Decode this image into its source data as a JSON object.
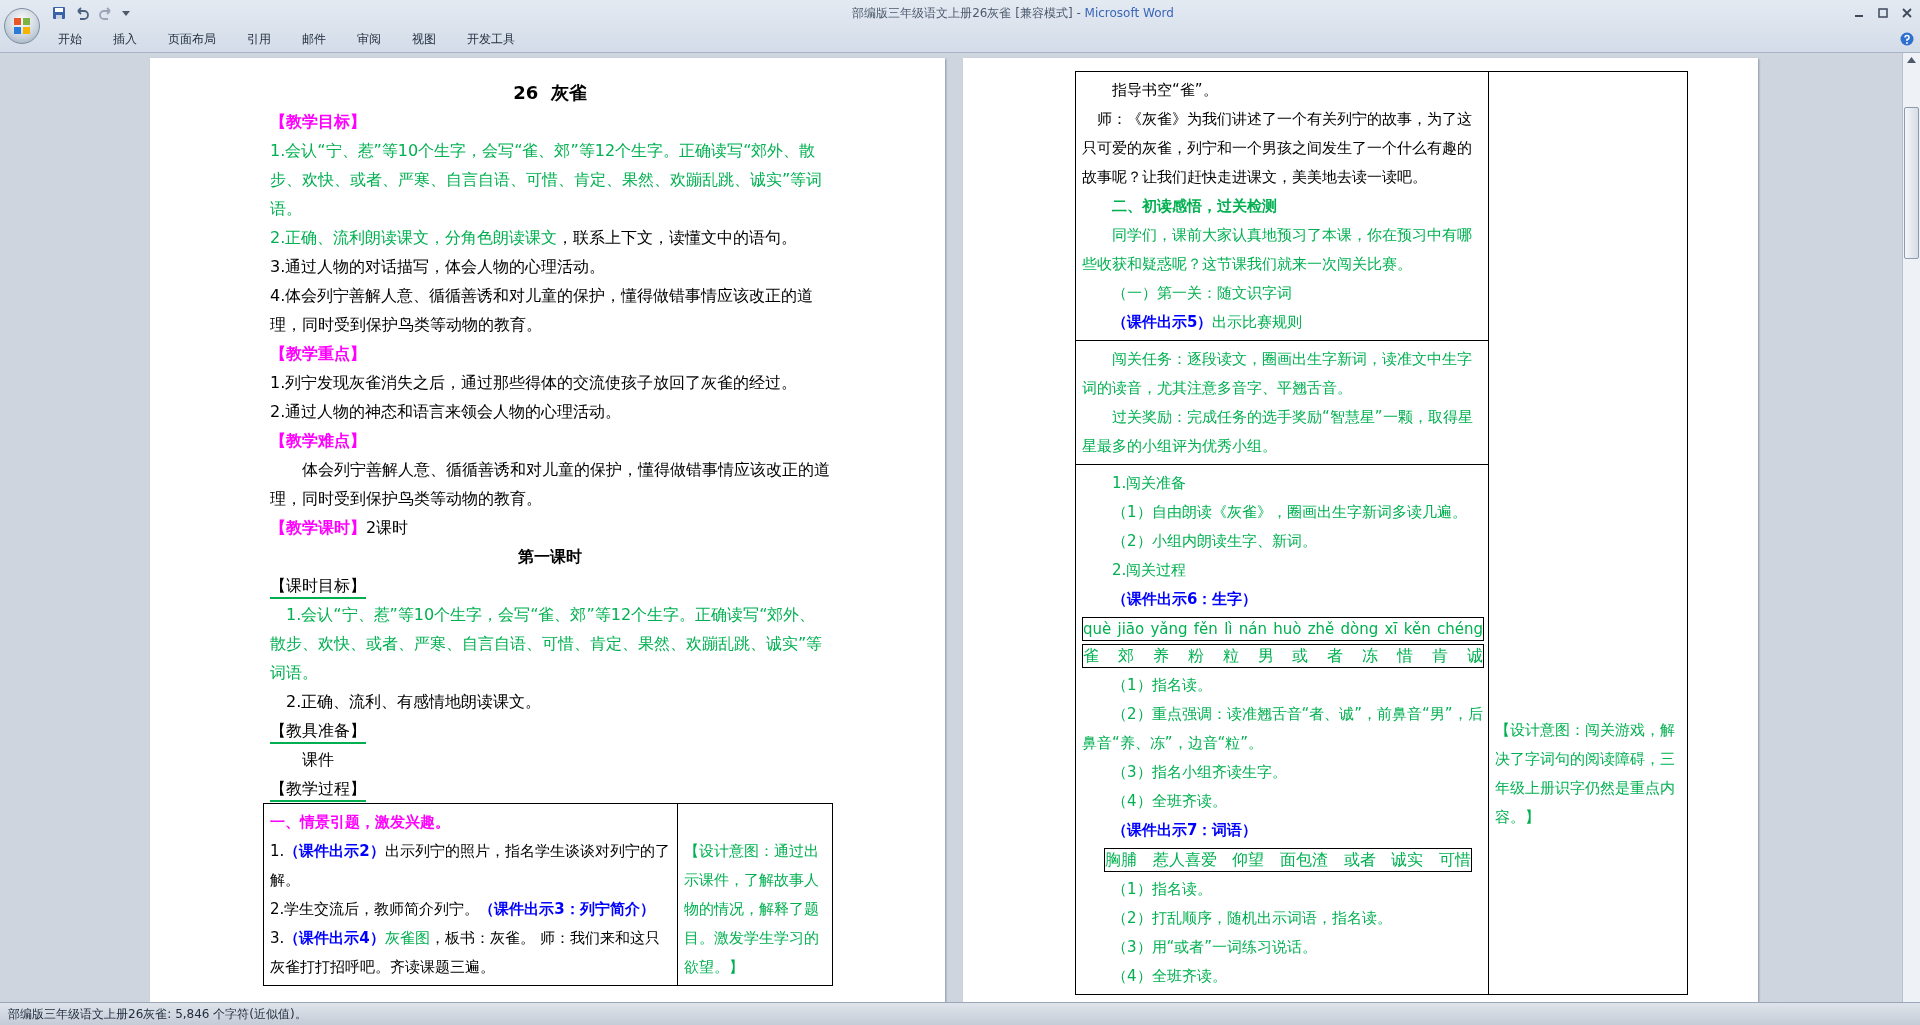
{
  "window": {
    "document_title": "部编版三年级语文上册26灰雀 [兼容模式]",
    "separator": " - ",
    "app_name": "Microsoft Word"
  },
  "ribbon_tabs": [
    {
      "label": "开始"
    },
    {
      "label": "插入"
    },
    {
      "label": "页面布局"
    },
    {
      "label": "引用"
    },
    {
      "label": "邮件"
    },
    {
      "label": "审阅"
    },
    {
      "label": "视图"
    },
    {
      "label": "开发工具"
    }
  ],
  "left_page": {
    "blocks": [
      {
        "kind": "title",
        "runs": [
          {
            "kind": "plain",
            "text": "26  灰雀"
          }
        ]
      },
      {
        "kind": "plain",
        "runs": [
          {
            "kind": "heading",
            "text": "【教学目标】"
          }
        ]
      },
      {
        "kind": "plain",
        "runs": [
          {
            "kind": "note",
            "text": "1.会认“宁、惹”等10个生字，会写“雀、郊”等12个生字。正确读写“郊外、散步、欢快、或者、严寒、自言自语、可惜、肯定、果然、欢蹦乱跳、诚实”等词语。"
          }
        ]
      },
      {
        "kind": "plain",
        "runs": [
          {
            "kind": "note",
            "text": "2.正确、流利朗读课文，分角色朗读课文"
          },
          {
            "kind": "plain",
            "text": "，联系上下文，读懂文中的语句。"
          }
        ]
      },
      {
        "kind": "plain",
        "runs": [
          {
            "kind": "plain",
            "text": "3.通过人物的对话描写，体会人物的心理活动。"
          }
        ]
      },
      {
        "kind": "plain",
        "runs": [
          {
            "kind": "plain",
            "text": "4.体会列宁善解人意、循循善诱和对儿童的保护，懂得做错事情应该改正的道理，同时受到保护鸟类等动物的教育。"
          }
        ]
      },
      {
        "kind": "plain",
        "runs": [
          {
            "kind": "heading",
            "text": "【教学重点】"
          }
        ]
      },
      {
        "kind": "plain",
        "runs": [
          {
            "kind": "plain",
            "text": "1.列宁发现灰雀消失之后，通过那些得体的交流使孩子放回了灰雀的经过。"
          }
        ]
      },
      {
        "kind": "plain",
        "runs": [
          {
            "kind": "plain",
            "text": "2.通过人物的神态和语言来领会人物的心理活动。"
          }
        ]
      },
      {
        "kind": "plain",
        "runs": [
          {
            "kind": "heading",
            "text": "【教学难点】"
          }
        ]
      },
      {
        "kind": "indented",
        "runs": [
          {
            "kind": "plain",
            "text": "体会列宁善解人意、循循善诱和对儿童的保护，懂得做错事情应该改正的道理，同时受到保护鸟类等动物的教育。"
          }
        ]
      },
      {
        "kind": "plain",
        "runs": [
          {
            "kind": "heading",
            "text": "【教学课时】"
          },
          {
            "kind": "plain",
            "text": "2课时"
          }
        ]
      },
      {
        "kind": "subtitle",
        "runs": [
          {
            "kind": "plain",
            "text": "第一课时"
          }
        ]
      },
      {
        "kind": "label",
        "runs": [
          {
            "kind": "plain",
            "text": "【课时目标】"
          }
        ]
      },
      {
        "kind": "half",
        "runs": [
          {
            "kind": "note",
            "text": "1.会认“宁、惹”等10个生字，会写“雀、郊”等12个生字。正确读写“郊外、散步、欢快、或者、严寒、自言自语、可惜、肯定、果然、欢蹦乱跳、诚实”等词语。"
          }
        ]
      },
      {
        "kind": "half",
        "runs": [
          {
            "kind": "plain",
            "text": "2.正确、流利、有感情地朗读课文。"
          }
        ]
      },
      {
        "kind": "label",
        "runs": [
          {
            "kind": "plain",
            "text": "【教具准备】"
          }
        ]
      },
      {
        "kind": "indented",
        "runs": [
          {
            "kind": "plain",
            "text": "课件"
          }
        ]
      },
      {
        "kind": "label",
        "runs": [
          {
            "kind": "plain",
            "text": "【教学过程】"
          }
        ]
      }
    ],
    "table": {
      "sections": [
        [
          {
            "kind": "plain",
            "runs": [
              {
                "kind": "heading",
                "text": "一、情景引题，激发兴趣。"
              }
            ]
          },
          {
            "kind": "plain",
            "runs": [
              {
                "kind": "plain",
                "text": "1."
              },
              {
                "kind": "courseware",
                "text": "（课件出示2）"
              },
              {
                "kind": "plain",
                "text": "出示列宁的照片，指名学生谈谈对列宁的了解。"
              }
            ]
          },
          {
            "kind": "plain",
            "runs": [
              {
                "kind": "plain",
                "text": "2.学生交流后，教师简介列宁。"
              },
              {
                "kind": "courseware",
                "text": "（课件出示3：列宁简介）"
              }
            ]
          },
          {
            "kind": "plain",
            "runs": [
              {
                "kind": "plain",
                "text": "3."
              },
              {
                "kind": "courseware",
                "text": "（课件出示4）"
              },
              {
                "kind": "note",
                "text": "灰雀图"
              },
              {
                "kind": "plain",
                "text": "，板书：灰雀。 师：我们来和这只灰雀打打招呼吧。齐读课题三遍。"
              }
            ]
          }
        ]
      ],
      "note": "【设计意图：通过出示课件，了解故事人物的情况，解释了题目。激发学生学习的欲望。】"
    }
  },
  "right_page": {
    "table": {
      "sections": [
        [
          {
            "kind": "indented",
            "runs": [
              {
                "kind": "plain",
                "text": "指导书空“雀”。"
              }
            ]
          },
          {
            "kind": "half",
            "runs": [
              {
                "kind": "plain",
                "text": "师：《灰雀》为我们讲述了一个有关列宁的故事，为了这只可爱的灰雀，列宁和一个男孩之间发生了一个什么有趣的故事呢？让我们赶快走进课文，美美地去读一读吧。"
              }
            ]
          },
          {
            "kind": "indented",
            "runs": [
              {
                "kind": "subheading",
                "text": "二、初读感悟，过关检测"
              }
            ]
          },
          {
            "kind": "indented",
            "runs": [
              {
                "kind": "note",
                "text": "同学们，课前大家认真地预习了本课，你在预习中有哪些收获和疑惑呢？这节课我们就来一次闯关比赛。"
              }
            ]
          },
          {
            "kind": "indented",
            "runs": [
              {
                "kind": "note",
                "text": "（一）第一关：随文识字词"
              }
            ]
          },
          {
            "kind": "indented",
            "runs": [
              {
                "kind": "courseware",
                "text": "（课件出示5）"
              },
              {
                "kind": "note",
                "text": "出示比赛规则"
              }
            ]
          }
        ],
        [
          {
            "kind": "indented",
            "runs": [
              {
                "kind": "note",
                "text": "闯关任务：逐段读文，圈画出生字新词，读准文中生字词的读音，尤其注意多音字、平翘舌音。"
              }
            ]
          },
          {
            "kind": "indented",
            "runs": [
              {
                "kind": "note",
                "text": "过关奖励：完成任务的选手奖励“智慧星”一颗，取得星星最多的小组评为优秀小组。"
              }
            ]
          }
        ],
        [
          {
            "kind": "indented",
            "runs": [
              {
                "kind": "note",
                "text": "1.闯关准备"
              }
            ]
          },
          {
            "kind": "indented",
            "runs": [
              {
                "kind": "note",
                "text": "（1）自由朗读《灰雀》，圈画出生字新词多读几遍。"
              }
            ]
          },
          {
            "kind": "indented",
            "runs": [
              {
                "kind": "note",
                "text": "（2）小组内朗读生字、新词。"
              }
            ]
          },
          {
            "kind": "indented",
            "runs": [
              {
                "kind": "note",
                "text": "2.闯关过程"
              }
            ]
          },
          {
            "kind": "indented",
            "runs": [
              {
                "kind": "courseware",
                "text": "（课件出示6：生字）"
              }
            ]
          },
          {
            "kind": "pinyin-box",
            "items": [
              "què",
              "jiāo",
              "yǎng",
              "fěn",
              "lì",
              "nán",
              "huò",
              "zhě",
              "dòng",
              "xī",
              "kěn",
              "chéng"
            ]
          },
          {
            "kind": "character-box",
            "items": [
              "雀",
              "郊",
              "养",
              "粉",
              "粒",
              "男",
              "或",
              "者",
              "冻",
              "惜",
              "肯",
              "诚"
            ]
          },
          {
            "kind": "indented",
            "runs": [
              {
                "kind": "note",
                "text": "（1）指名读。"
              }
            ]
          },
          {
            "kind": "indented",
            "runs": [
              {
                "kind": "note",
                "text": "（2）重点强调：读准翘舌音“者、诚”，前鼻音“男”，后鼻音“养、冻”，边音“粒”。"
              }
            ]
          },
          {
            "kind": "indented",
            "runs": [
              {
                "kind": "note",
                "text": "（3）指名小组齐读生字。"
              }
            ]
          },
          {
            "kind": "indented",
            "runs": [
              {
                "kind": "note",
                "text": "（4）全班齐读。"
              }
            ]
          },
          {
            "kind": "indented",
            "runs": [
              {
                "kind": "courseware",
                "text": "（课件出示7：词语）"
              }
            ]
          },
          {
            "kind": "word-box",
            "items": [
              "胸脯",
              "惹人喜爱",
              "仰望",
              "面包渣",
              "或者",
              "诚实",
              "可惜"
            ]
          },
          {
            "kind": "indented",
            "runs": [
              {
                "kind": "note",
                "text": "（1）指名读。"
              }
            ]
          },
          {
            "kind": "indented",
            "runs": [
              {
                "kind": "note",
                "text": "（2）打乱顺序，随机出示词语，指名读。"
              }
            ]
          },
          {
            "kind": "indented",
            "runs": [
              {
                "kind": "note",
                "text": "（3）用“或者”一词练习说话。"
              }
            ]
          },
          {
            "kind": "indented",
            "runs": [
              {
                "kind": "note",
                "text": "（4）全班齐读。"
              }
            ]
          }
        ]
      ],
      "note": "【设计意图：闯关游戏，解决了字词句的阅读障碍，三年级上册识字仍然是重点内容。】"
    }
  },
  "status_bar": "部编版三年级语文上册26灰雀: 5,846 个字符(近似值)。"
}
